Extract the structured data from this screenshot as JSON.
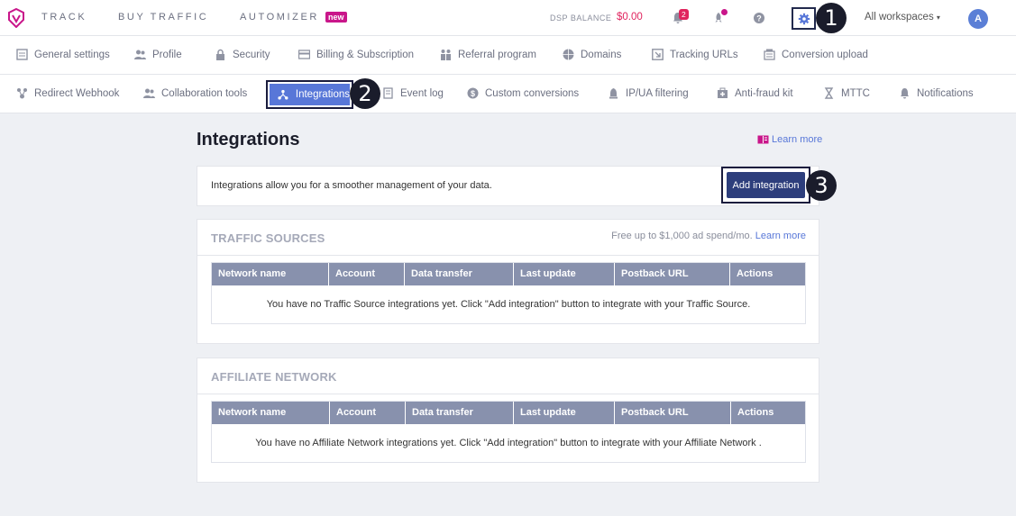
{
  "topnav": {
    "track": "TRACK",
    "buy_traffic": "BUY TRAFFIC",
    "automizer": "AUTOMIZER",
    "automizer_badge": "new",
    "dsp_balance_label": "DSP BALANCE",
    "dsp_balance_value": "$0.00",
    "notifications_count": "2",
    "workspace": "All workspaces",
    "avatar_initial": "A",
    "icons": [
      "bell-icon",
      "rocket-icon",
      "help-icon",
      "gear-icon"
    ]
  },
  "tabs_row1": [
    {
      "label": "General settings",
      "icon": "sliders-icon"
    },
    {
      "label": "Profile",
      "icon": "users-icon"
    },
    {
      "label": "Security",
      "icon": "lock-icon"
    },
    {
      "label": "Billing & Subscription",
      "icon": "card-icon"
    },
    {
      "label": "Referral program",
      "icon": "referral-icon"
    },
    {
      "label": "Domains",
      "icon": "globe-icon"
    },
    {
      "label": "Tracking URLs",
      "icon": "link-icon"
    },
    {
      "label": "Conversion upload",
      "icon": "upload-icon"
    }
  ],
  "tabs_row2": [
    {
      "label": "Redirect Webhook",
      "icon": "webhook-icon"
    },
    {
      "label": "Collaboration tools",
      "icon": "team-icon"
    },
    {
      "label": "Integrations",
      "icon": "integrations-icon",
      "active": true
    },
    {
      "label": "Event log",
      "icon": "log-icon"
    },
    {
      "label": "Custom conversions",
      "icon": "dollar-icon"
    },
    {
      "label": "IP/UA filtering",
      "icon": "filter-icon"
    },
    {
      "label": "Anti-fraud kit",
      "icon": "shield-icon"
    },
    {
      "label": "MTTC",
      "icon": "hourglass-icon"
    },
    {
      "label": "Notifications",
      "icon": "bell-icon"
    }
  ],
  "steps": [
    "1",
    "2",
    "3"
  ],
  "page": {
    "title": "Integrations",
    "learn_more": "Learn more",
    "info_text": "Integrations allow you for a smoother management of your data.",
    "add_button": "Add integration"
  },
  "traffic_sources": {
    "title": "TRAFFIC SOURCES",
    "note": "Free up to $1,000 ad spend/mo.",
    "note_link": "Learn more",
    "columns": [
      "Network name",
      "Account",
      "Data transfer",
      "Last update",
      "Postback URL",
      "Actions"
    ],
    "empty": "You have no Traffic Source integrations yet. Click \"Add integration\" button to integrate with your Traffic Source."
  },
  "affiliate_network": {
    "title": "AFFILIATE NETWORK",
    "columns": [
      "Network name",
      "Account",
      "Data transfer",
      "Last update",
      "Postback URL",
      "Actions"
    ],
    "empty": "You have no Affiliate Network integrations yet. Click \"Add integration\" button to integrate with your Affiliate Network ."
  },
  "colors": {
    "accent": "#5877d8",
    "primary_button": "#2d3e7c",
    "brand": "#c9168a",
    "danger": "#e0245e",
    "table_header": "#8891ad"
  }
}
